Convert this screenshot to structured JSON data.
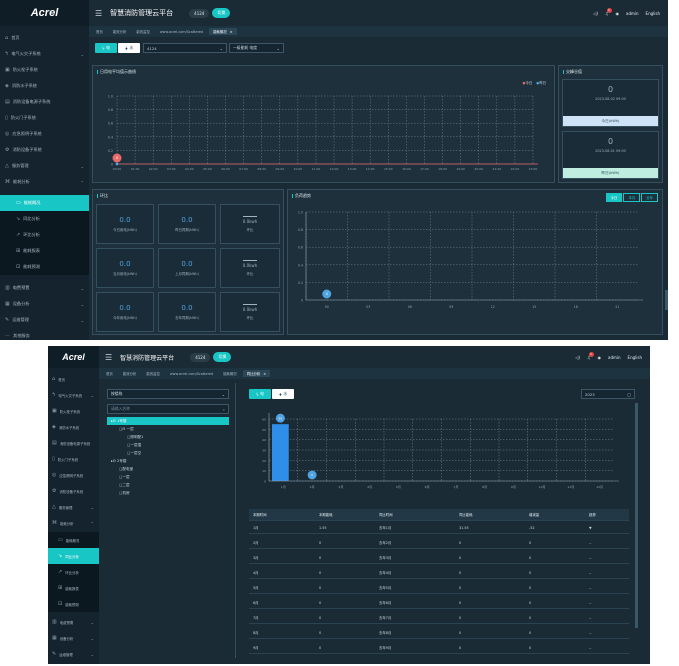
{
  "brand": "Acrel",
  "app_title": "智慧消防管理云平台",
  "station_code": "4124",
  "switch_label": "切换",
  "user": "admin",
  "language": "English",
  "alarm_count": "1",
  "colors": {
    "accent": "#19c6c6",
    "bg": "#1b2b36",
    "sidebar": "#14232d",
    "bar": "#2f8fe8",
    "marker": "#e86a6a"
  },
  "nav": {
    "home": "首页",
    "electric_fire": "电气火灾子系统",
    "fire_hydrant": "防火栓子系统",
    "water": "消防水子系统",
    "power_monitor": "消防设备电源子系统",
    "fire_door": "防火门子系统",
    "emergency_light": "应急照明子系统",
    "fire_equipment": "消防设备子系统",
    "service": "服务管理",
    "energy": "能耗分析",
    "energy_overview": "能耗概况",
    "yoy": "同比分析",
    "mom": "环比分析",
    "report": "能耗报表",
    "forecast": "能耗预测",
    "tariff": "电费预置",
    "device": "设备分析",
    "operation": "运维管理",
    "more": "其他服务"
  },
  "tabs": [
    "首页",
    "能效分析",
    "能效监控",
    "www.acrel.com/Scattered",
    "能耗概况",
    "同比分析"
  ],
  "s1": {
    "electric": "电",
    "water": "水",
    "station_select": "4124",
    "meter_select": "一级能耗 电度",
    "daily_title": "日用电平均值示曲线",
    "legend_today": "今日",
    "legend_yesterday": "昨日",
    "peak_title": "尖峰谷值",
    "peak_value": "0",
    "peak_time_1": "2023-08-02 09:00",
    "peak_label_1": "今日(kWh)",
    "peak_time_2": "2023-08-01 09:00",
    "peak_label_2": "昨日(kWh)",
    "compare_title": "环比",
    "trend_title": "负荷趋势",
    "seg_day": "今日",
    "seg_month": "本月",
    "seg_year": "全年",
    "marker_label": "0",
    "card_zero": "0.0",
    "card_delta": "0.0kwh",
    "card_today": "今日用电(kWh)",
    "card_yesterday_same": "昨日同期(kWh)",
    "card_ratio": "环比",
    "card_month": "当月用电(kWh)",
    "card_lastmonth_same": "上月同期(kWh)",
    "card_year": "今年用电(kWh)",
    "card_lastyear_same": "去年同期(kWh)"
  },
  "s2": {
    "electric": "电",
    "water": "水",
    "tree_select": "按楼栋",
    "search_placeholder": "请输入名称",
    "year_select": "2023",
    "tree": [
      {
        "label": "⊟ 1号楼",
        "level": 0,
        "sel": true
      },
      {
        "label": "⊟ 一层",
        "level": 1
      },
      {
        "label": "照明配1",
        "level": 2
      },
      {
        "label": "一层插",
        "level": 2
      },
      {
        "label": "一层空",
        "level": 2
      },
      {
        "label": "⊟ 2号楼",
        "level": 0
      },
      {
        "label": "配电室",
        "level": 1
      },
      {
        "label": "一层",
        "level": 1
      },
      {
        "label": "二层",
        "level": 1
      },
      {
        "label": "机房",
        "level": 1
      }
    ],
    "table_headers": [
      "本期时间",
      "本期能耗",
      "同比时间",
      "同比能耗",
      "增减量",
      "趋势"
    ],
    "table_rows": [
      [
        "1月",
        "1.55",
        "去年1月",
        "31.55",
        "-52",
        "▼"
      ],
      [
        "2月",
        "0",
        "去年2月",
        "0",
        "0",
        "--"
      ],
      [
        "3月",
        "0",
        "去年3月",
        "0",
        "0",
        "--"
      ],
      [
        "4月",
        "0",
        "去年4月",
        "0",
        "0",
        "--"
      ],
      [
        "5月",
        "0",
        "去年5月",
        "0",
        "0",
        "--"
      ],
      [
        "6月",
        "0",
        "去年6月",
        "0",
        "0",
        "--"
      ],
      [
        "7月",
        "0",
        "去年7月",
        "0",
        "0",
        "--"
      ],
      [
        "8月",
        "0",
        "去年8月",
        "0",
        "0",
        "--"
      ],
      [
        "9月",
        "0",
        "去年9月",
        "0",
        "0",
        "--"
      ]
    ],
    "bar_label": "55",
    "marker_label": "0"
  },
  "chart_data": [
    {
      "type": "line",
      "series": [
        {
          "name": "今日",
          "values": [
            0
          ]
        },
        {
          "name": "昨日",
          "values": [
            0
          ]
        }
      ],
      "x": [
        "00:00",
        "01:00",
        "02:00",
        "03:00",
        "04:00",
        "05:00",
        "06:00",
        "07:00",
        "08:00",
        "09:00",
        "10:00",
        "11:00",
        "12:00",
        "13:00",
        "14:00",
        "15:00",
        "16:00",
        "17:00",
        "18:00",
        "19:00",
        "20:00",
        "21:00",
        "22:00",
        "23:00"
      ],
      "ylim": [
        0,
        1.0
      ],
      "y_ticks": [
        "0",
        "0.2",
        "0.4",
        "0.6",
        "0.8",
        "1.0"
      ],
      "grid": true
    },
    {
      "type": "line",
      "x": [
        "00",
        "03",
        "06",
        "09",
        "12",
        "15",
        "18",
        "21"
      ],
      "series": [
        {
          "values": [
            0
          ]
        }
      ],
      "ylim": [
        0,
        1.0
      ],
      "y_ticks": [
        "0",
        "0.2",
        "0.4",
        "0.6",
        "0.8",
        "1.0"
      ],
      "grid": true
    },
    {
      "type": "bar",
      "categories": [
        "1月",
        "2月",
        "3月",
        "4月",
        "5月",
        "6月",
        "7月",
        "8月",
        "9月",
        "10月",
        "11月",
        "12月"
      ],
      "series": [
        {
          "values": [
            55,
            0,
            0,
            0,
            0,
            0,
            0,
            0,
            0,
            0,
            0,
            0
          ]
        },
        {
          "values": [
            0,
            0,
            0,
            0,
            0,
            0,
            0,
            0,
            0,
            0,
            0,
            0
          ]
        }
      ],
      "ylim": [
        0,
        60
      ],
      "y_ticks": [
        "0",
        "10",
        "20",
        "30",
        "40",
        "50",
        "60"
      ],
      "grid": true
    }
  ]
}
